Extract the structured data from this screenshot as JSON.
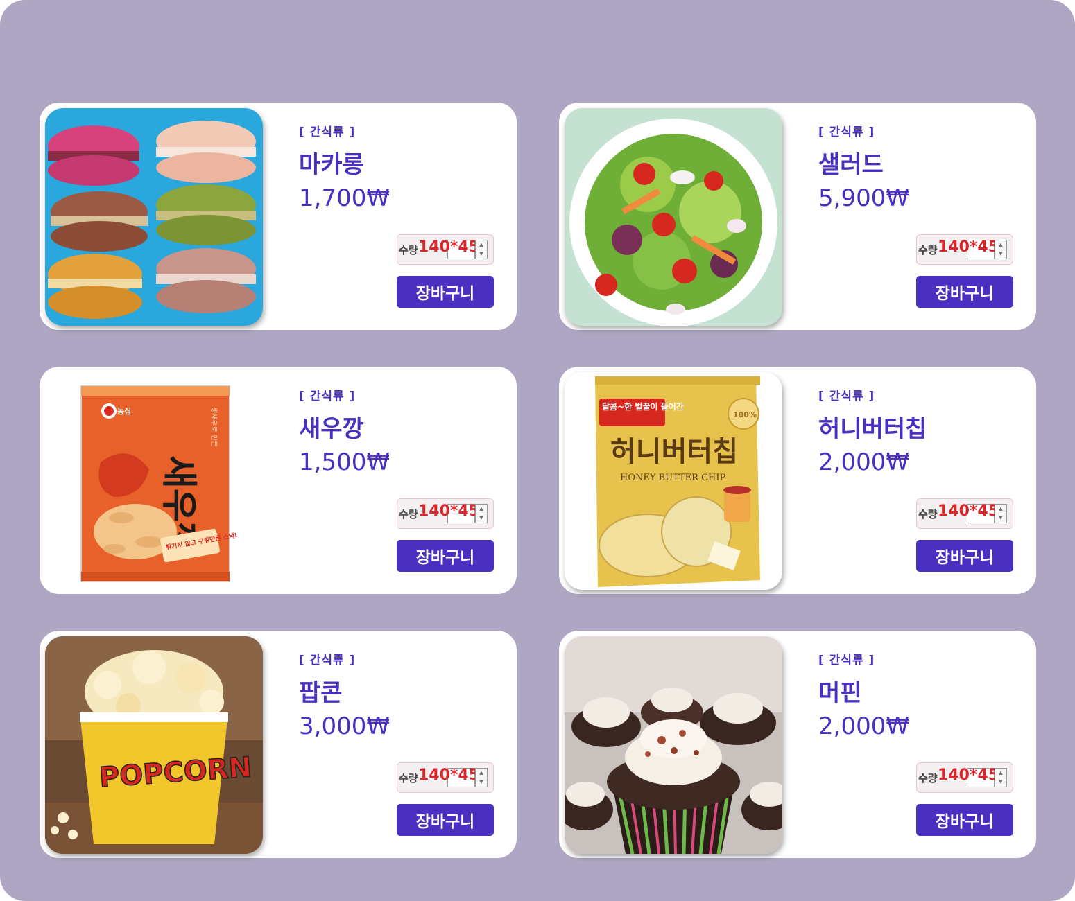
{
  "products": [
    {
      "category": "[ 간식류 ]",
      "name": "마카롱",
      "price": "1,700₩",
      "qty_label": "수량",
      "qty_overlay": "140*45",
      "cart_label": "장바구니",
      "image_icon": "macaron-image"
    },
    {
      "category": "[ 간식류 ]",
      "name": "샐러드",
      "price": "5,900₩",
      "qty_label": "수량",
      "qty_overlay": "140*45",
      "cart_label": "장바구니",
      "image_icon": "salad-image"
    },
    {
      "category": "[ 간식류 ]",
      "name": "새우깡",
      "price": "1,500₩",
      "qty_label": "수량",
      "qty_overlay": "140*45",
      "cart_label": "장바구니",
      "image_icon": "shrimp-snack-image",
      "pack_text": {
        "brand": "농심",
        "title": "새우깡",
        "side": "생새우로 만든",
        "badge": "튀기지 않고 구워만든 스낵!"
      }
    },
    {
      "category": "[ 간식류 ]",
      "name": "허니버터칩",
      "price": "2,000₩",
      "qty_label": "수량",
      "qty_overlay": "140*45",
      "cart_label": "장바구니",
      "image_icon": "honey-butter-chip-image",
      "pack_text": {
        "top": "달콤~한 벌꿀이 들어간",
        "title": "허니버터칩",
        "subtitle": "HONEY BUTTER CHIP",
        "badge": "100%"
      }
    },
    {
      "category": "[ 간식류 ]",
      "name": "팝콘",
      "price": "3,000₩",
      "qty_label": "수량",
      "qty_overlay": "140*45",
      "cart_label": "장바구니",
      "image_icon": "popcorn-image",
      "pack_text": {
        "bucket": "POPCORN"
      }
    },
    {
      "category": "[ 간식류 ]",
      "name": "머핀",
      "price": "2,000₩",
      "qty_label": "수량",
      "qty_overlay": "140*45",
      "cart_label": "장바구니",
      "image_icon": "muffin-image"
    }
  ],
  "colors": {
    "accent": "#4a2fc0",
    "background": "#aea6c2",
    "overlay_red": "#d9262b"
  }
}
